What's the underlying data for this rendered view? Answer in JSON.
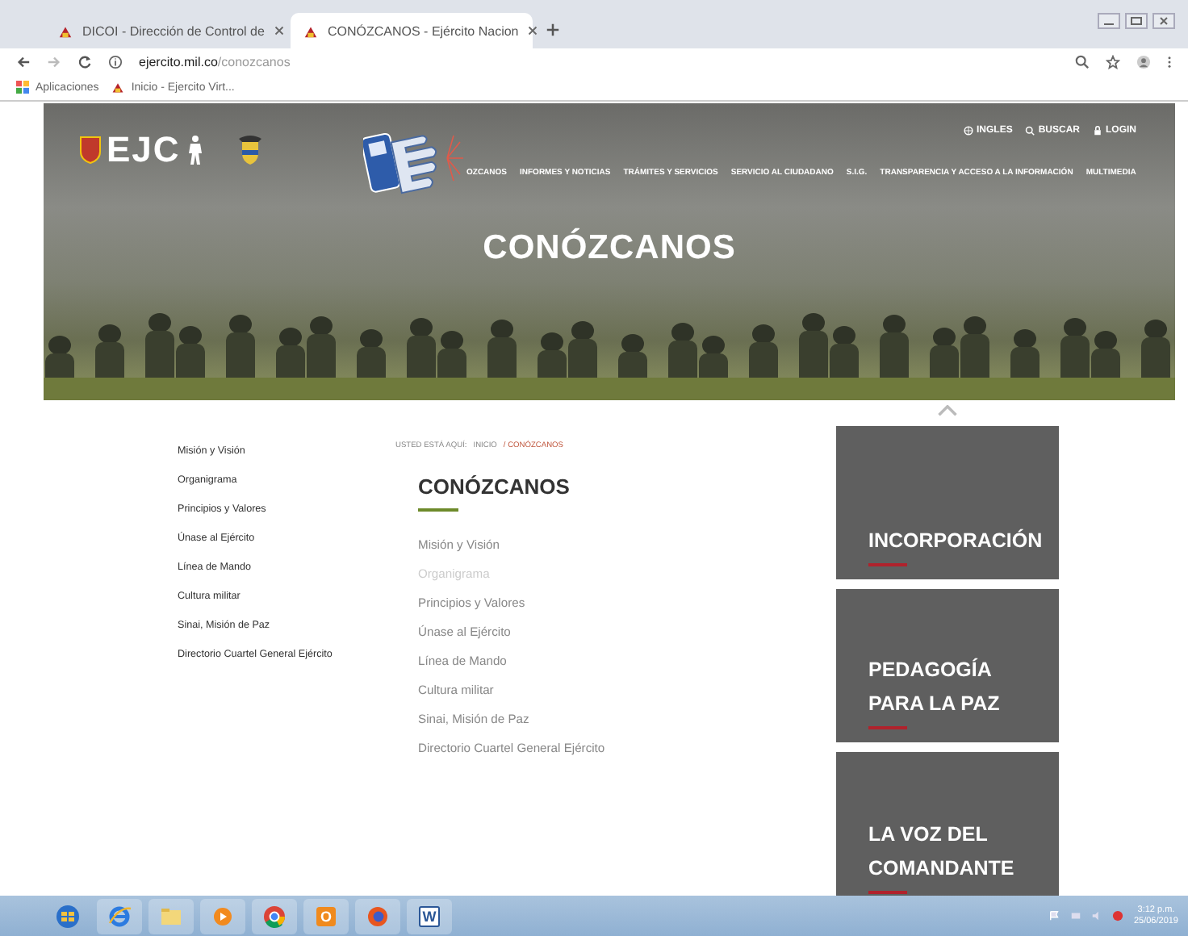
{
  "browser": {
    "tabs": [
      {
        "title": "DICOI - Dirección de Control de",
        "selected": false
      },
      {
        "title": "CONÓZCANOS - Ejército Nacion",
        "selected": true
      }
    ],
    "url_host": "ejercito.mil.co",
    "url_path": "/conozcanos",
    "bookmarks": [
      "Aplicaciones",
      "Inicio - Ejercito Virt..."
    ]
  },
  "header": {
    "logo": "EJC",
    "utility_links": [
      "INGLES",
      "BUSCAR",
      "LOGIN"
    ],
    "nav": [
      "OZCANOS",
      "INFORMES Y NOTICIAS",
      "TRÁMITES Y SERVICIOS",
      "SERVICIO AL CIUDADANO",
      "S.I.G.",
      "TRANSPARENCIA Y ACCESO A LA INFORMACIÓN",
      "MULTIMEDIA"
    ],
    "title": "CONÓZCANOS"
  },
  "sidebar": {
    "items": [
      "Misión y Visión",
      "Organigrama",
      "Principios y Valores",
      "Únase al Ejército",
      "Línea de Mando",
      "Cultura militar",
      "Sinai, Misión de Paz",
      "Directorio Cuartel General Ejército"
    ]
  },
  "breadcrumb": {
    "label": "USTED ESTÁ AQUÍ:",
    "items": [
      "INICIO",
      "/ CONÓZCANOS"
    ]
  },
  "content": {
    "title": "CONÓZCANOS",
    "links": [
      {
        "label": "Misión y Visión",
        "selected": false
      },
      {
        "label": "Organigrama",
        "selected": true
      },
      {
        "label": "Principios y Valores",
        "selected": false
      },
      {
        "label": "Únase al Ejército",
        "selected": false
      },
      {
        "label": "Línea de Mando",
        "selected": false
      },
      {
        "label": "Cultura militar",
        "selected": false
      },
      {
        "label": "Sinai, Misión de Paz",
        "selected": false
      },
      {
        "label": "Directorio Cuartel General Ejército",
        "selected": false
      }
    ]
  },
  "promo_cards": [
    "INCORPORACIÓN",
    "PEDAGOGÍA PARA LA PAZ",
    "LA VOZ DEL COMANDANTE"
  ],
  "taskbar": {
    "apps": [
      {
        "kind": "start"
      },
      {
        "kind": "ie"
      },
      {
        "kind": "folder"
      },
      {
        "kind": "media"
      },
      {
        "kind": "chrome"
      },
      {
        "kind": "outlook",
        "label": "O"
      },
      {
        "kind": "firefox"
      },
      {
        "kind": "word",
        "label": "W"
      }
    ],
    "time": "3:12 p.m.",
    "date": "25/06/2019"
  }
}
